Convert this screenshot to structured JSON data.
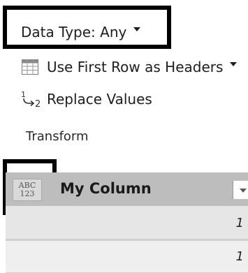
{
  "ribbon": {
    "data_type_label": "Data Type: Any",
    "first_row_label": "Use First Row as Headers",
    "replace_values_label": "Replace Values",
    "replace_icon_sup": "1",
    "replace_icon_sub": "2",
    "group_label": "Transform"
  },
  "column": {
    "type_icon_top": "ABC",
    "type_icon_bottom": "123",
    "name": "My Column",
    "rows": [
      "1",
      "1"
    ]
  },
  "colors": {
    "highlight_border": "#000000",
    "header_bg": "#bdbdbd",
    "row_bg": "#e6e6e6"
  }
}
